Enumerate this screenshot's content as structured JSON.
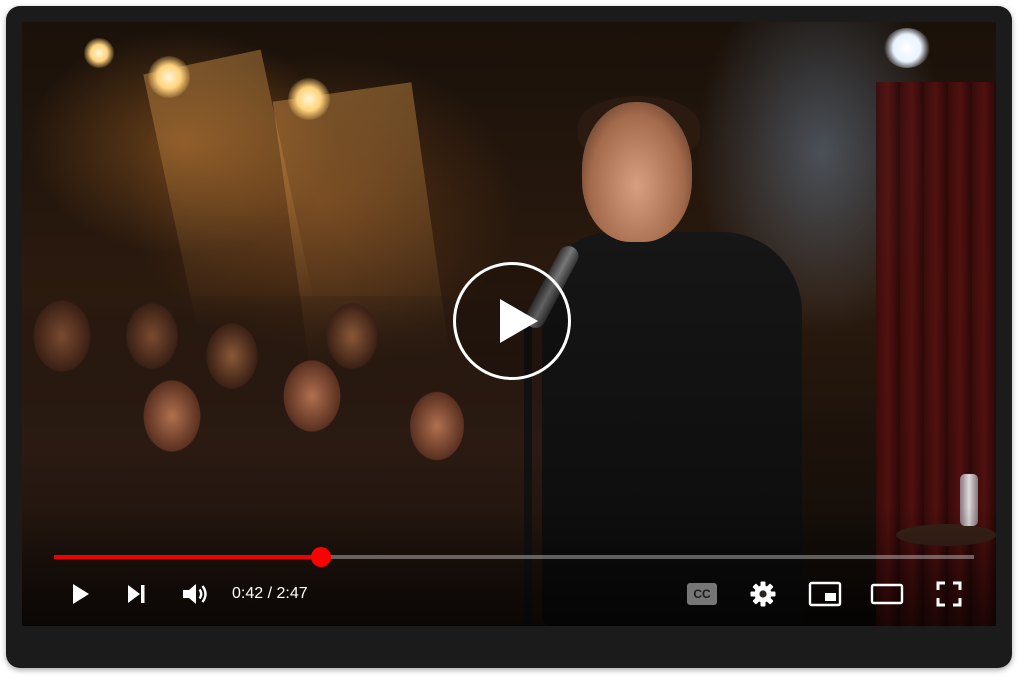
{
  "player": {
    "current_time": "0:42",
    "separator": " / ",
    "duration": "2:47",
    "progress_fraction": 0.29,
    "cc_label": "CC"
  },
  "colors": {
    "progress_played": "#f00000",
    "progress_handle": "#ff0000",
    "progress_track": "rgba(255,255,255,0.35)",
    "icon": "#ffffff",
    "frame": "#1b1b1b"
  },
  "icons": {
    "center": "play-overlay-icon",
    "play": "play-icon",
    "next": "next-icon",
    "volume": "volume-icon",
    "captions": "captions-icon",
    "settings": "gear-icon",
    "miniplayer": "miniplayer-icon",
    "theater": "theater-mode-icon",
    "fullscreen": "fullscreen-icon"
  }
}
